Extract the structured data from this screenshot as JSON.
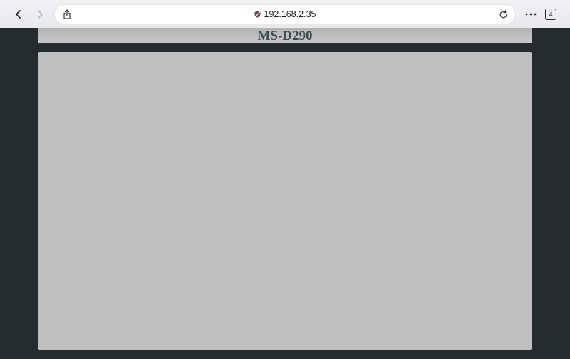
{
  "browser": {
    "url": "192.168.2.35",
    "tab_count": "4",
    "icons": {
      "back": "chevron-left-icon",
      "forward": "chevron-right-icon",
      "share": "share-icon",
      "security": "not-secure-shield-icon",
      "reload": "reload-icon",
      "more": "more-dots-icon",
      "tabs": "tabs-icon"
    }
  },
  "page": {
    "title": "MS-D290"
  },
  "colors": {
    "page_background": "#262b2e",
    "panel": "#c0c0c0",
    "header": "#b9b9b9",
    "title_text": "#3a4f50"
  }
}
